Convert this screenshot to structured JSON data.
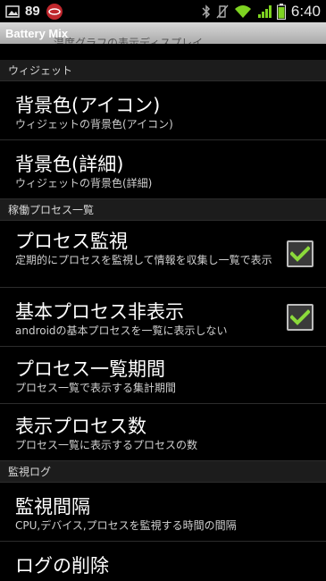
{
  "status_bar": {
    "notification_count": "89",
    "time": "6:40"
  },
  "title_bar": {
    "title": "Battery Mix",
    "ghost_text": "温度グラフの表示ディスプレイ"
  },
  "sections": {
    "widget": {
      "header": "ウィジェット",
      "items": [
        {
          "title": "背景色(アイコン)",
          "summary": "ウィジェットの背景色(アイコン)"
        },
        {
          "title": "背景色(詳細)",
          "summary": "ウィジェットの背景色(詳細)"
        }
      ]
    },
    "process": {
      "header": "稼働プロセス一覧",
      "items": [
        {
          "title": "プロセス監視",
          "summary": "定期的にプロセスを監視して情報を収集し一覧で表示",
          "checked": true
        },
        {
          "title": "基本プロセス非表示",
          "summary": "androidの基本プロセスを一覧に表示しない",
          "checked": true
        },
        {
          "title": "プロセス一覧期間",
          "summary": "プロセス一覧で表示する集計期間"
        },
        {
          "title": "表示プロセス数",
          "summary": "プロセス一覧に表示するプロセスの数"
        }
      ]
    },
    "monitor_log": {
      "header": "監視ログ",
      "items": [
        {
          "title": "監視間隔",
          "summary": "CPU,デバイス,プロセスを監視する時間の間隔"
        },
        {
          "title": "ログの削除",
          "summary": ""
        }
      ]
    }
  },
  "colors": {
    "accent_green": "#8bd93b",
    "wifi_green": "#7ed321",
    "battery_green": "#7ed321"
  }
}
